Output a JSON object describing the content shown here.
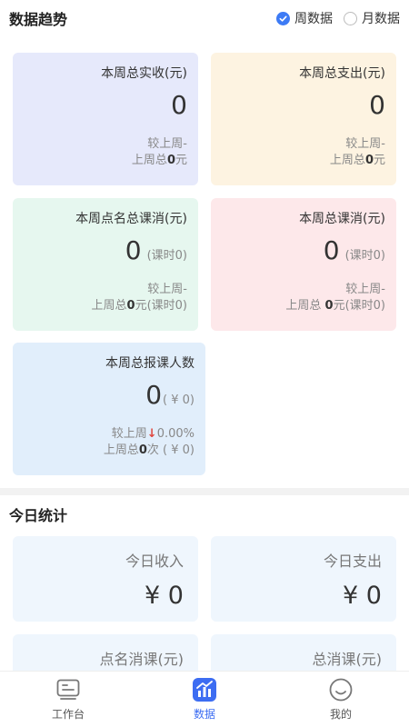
{
  "trend": {
    "title": "数据趋势",
    "options": [
      {
        "label": "周数据",
        "checked": true
      },
      {
        "label": "月数据",
        "checked": false
      }
    ]
  },
  "cards": {
    "revenue": {
      "label": "本周总实收(元)",
      "value": "0",
      "compare1": "较上周-",
      "compare_prefix": "上周总",
      "compare_value": "0",
      "compare_suffix": "元"
    },
    "expense": {
      "label": "本周总支出(元)",
      "value": "0",
      "compare1": "较上周-",
      "compare_prefix": "上周总",
      "compare_value": "0",
      "compare_suffix": "元"
    },
    "rollcall": {
      "label": "本周点名总课消(元)",
      "value": "0",
      "unit": "(课时0)",
      "compare1": "较上周-",
      "compare_prefix": "上周总",
      "compare_value": "0",
      "compare_suffix": "元(课时0)"
    },
    "consume": {
      "label": "本周总课消(元)",
      "value": "0",
      "unit": "(课时0)",
      "compare1": "较上周-",
      "compare_prefix": "上周总 ",
      "compare_value": "0",
      "compare_suffix": "元(课时0)"
    },
    "enroll": {
      "label": "本周总报课人数",
      "value": "0",
      "unit": "( ¥ 0)",
      "compare_text": "较上周",
      "compare_arrow": "↓",
      "compare_pct": "0.00%",
      "compare_prefix": "上周总",
      "compare_value": "0",
      "compare_suffix": "次 ( ¥ 0)"
    }
  },
  "today": {
    "title": "今日统计",
    "income": {
      "label": "今日收入",
      "value": "¥ 0"
    },
    "expense": {
      "label": "今日支出",
      "value": "¥ 0"
    },
    "rollcall": {
      "label": "点名消课(元)"
    },
    "consume": {
      "label": "总消课(元)"
    }
  },
  "tabbar": {
    "items": [
      {
        "label": "工作台",
        "icon": "workbench-icon",
        "active": false
      },
      {
        "label": "数据",
        "icon": "chart-icon",
        "active": true
      },
      {
        "label": "我的",
        "icon": "smile-icon",
        "active": false
      }
    ]
  },
  "colors": {
    "accent": "#3d6df2",
    "down": "#e0463e"
  }
}
